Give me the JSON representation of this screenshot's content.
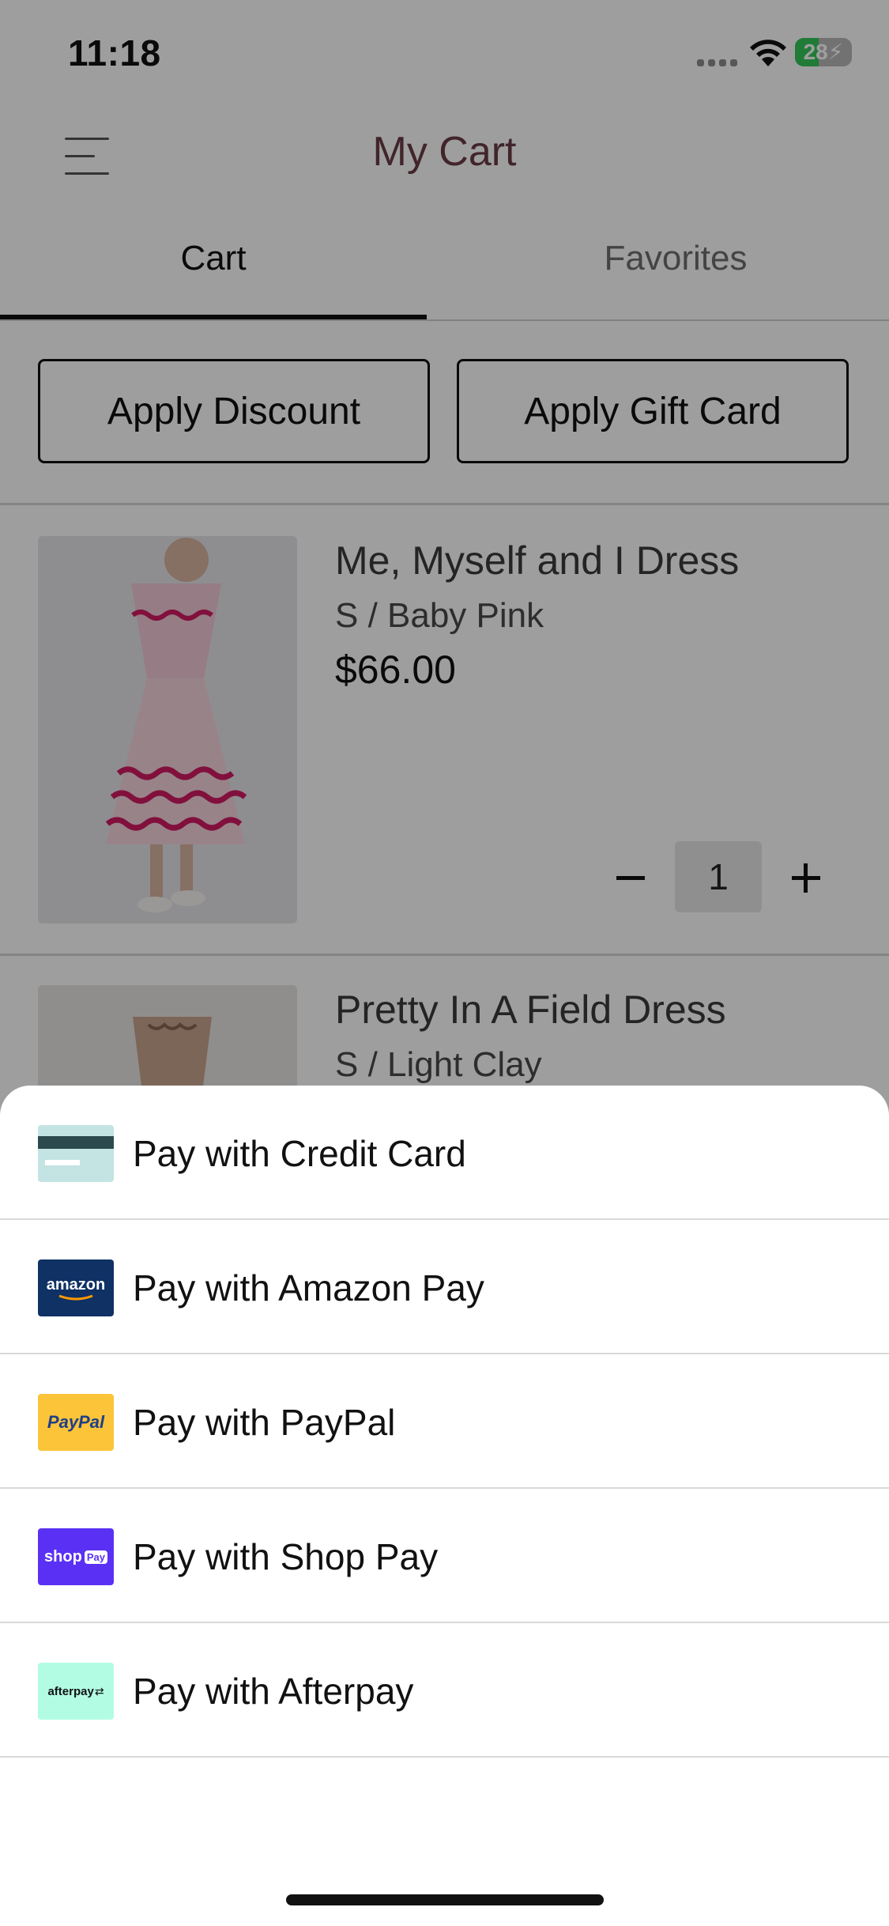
{
  "status_bar": {
    "time": "11:18",
    "battery_percent": "28"
  },
  "header": {
    "title": "My Cart",
    "menu_icon": "hamburger-menu-icon"
  },
  "tabs": [
    {
      "label": "Cart",
      "active": true
    },
    {
      "label": "Favorites",
      "active": false
    }
  ],
  "actions": {
    "discount_label": "Apply Discount",
    "gift_card_label": "Apply Gift Card"
  },
  "cart_items": [
    {
      "name": "Me, Myself and I Dress",
      "variant": "S / Baby Pink",
      "price": "$66.00",
      "quantity": "1"
    },
    {
      "name": "Pretty In A Field Dress",
      "variant": "S / Light Clay"
    }
  ],
  "payment_options": [
    {
      "label": "Pay with Credit Card",
      "icon": "credit-card-icon",
      "color": "#c4e3e3"
    },
    {
      "label": "Pay with Amazon Pay",
      "icon": "amazon-pay-logo",
      "logo_text": "amazon",
      "color": "#0f3164"
    },
    {
      "label": "Pay with PayPal",
      "icon": "paypal-logo",
      "logo_text": "PayPal",
      "color": "#fbc439"
    },
    {
      "label": "Pay with Shop Pay",
      "icon": "shop-pay-logo",
      "logo_text": "shop",
      "logo_badge": "Pay",
      "color": "#5a31f4"
    },
    {
      "label": "Pay with Afterpay",
      "icon": "afterpay-logo",
      "logo_text": "afterpay",
      "color": "#b2fce4"
    }
  ],
  "colors": {
    "title": "#6a3c46",
    "overlay": "rgba(0,0,0,0.38)"
  }
}
